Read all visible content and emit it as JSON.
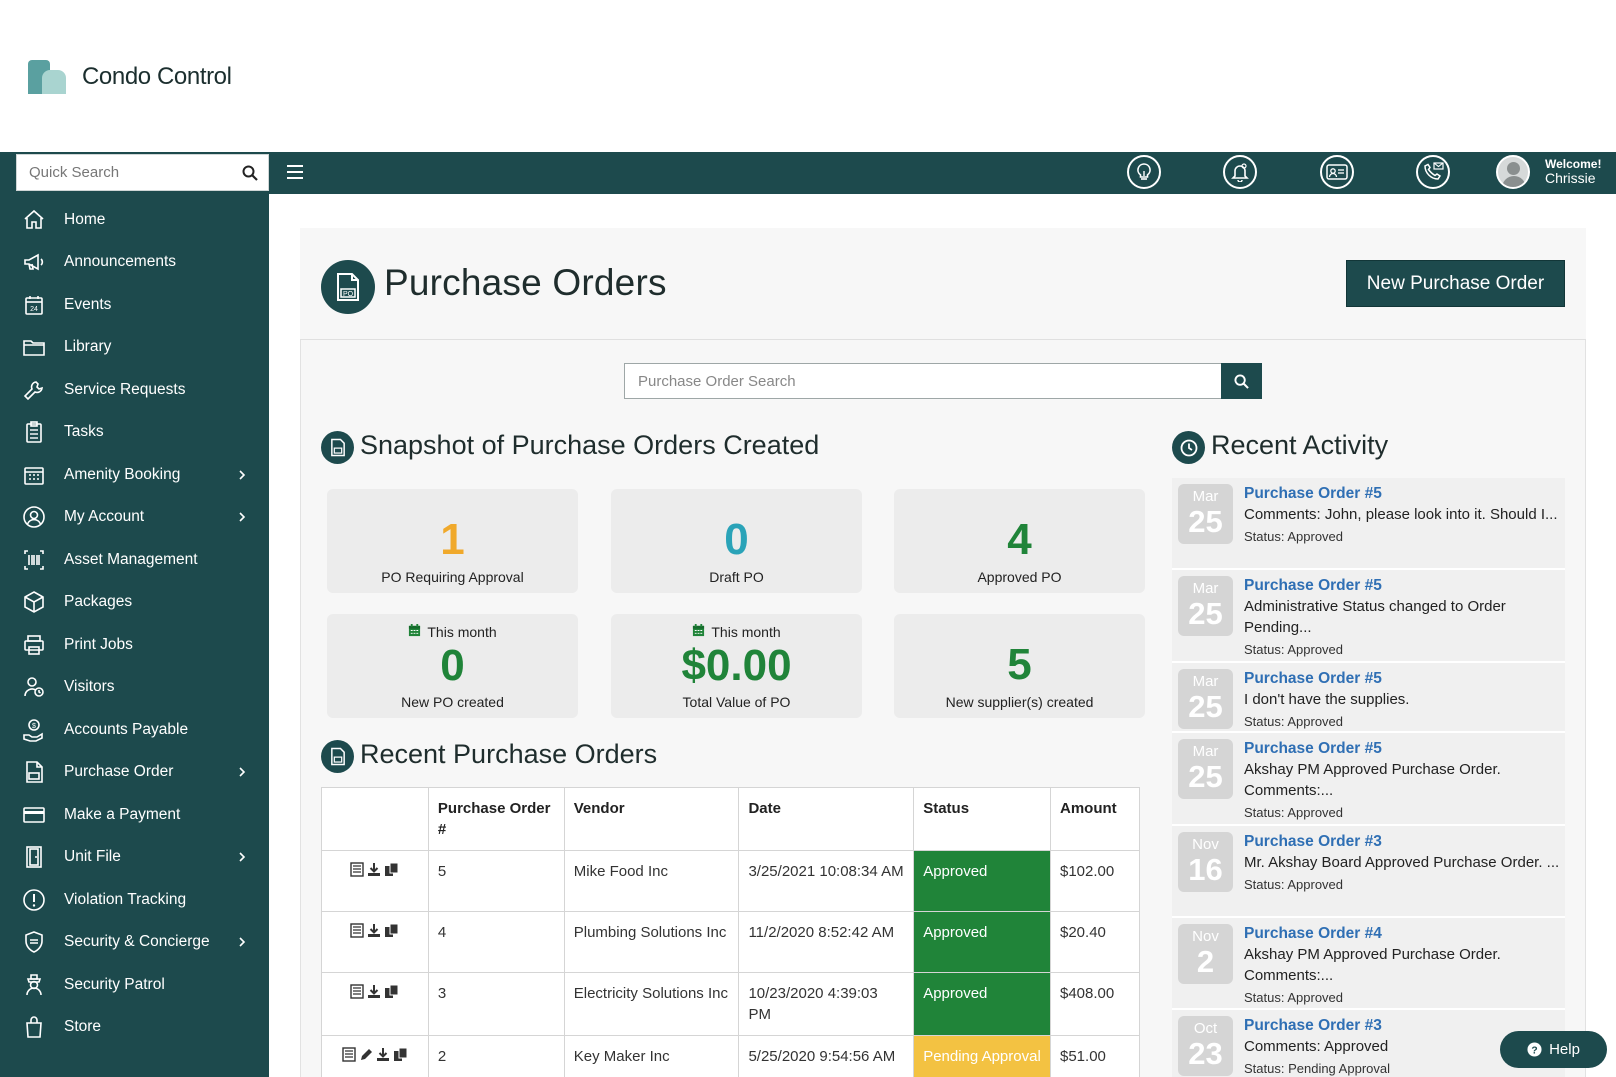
{
  "brand": {
    "name": "Condo Control"
  },
  "topbar": {
    "search_placeholder": "Quick Search",
    "welcome_label": "Welcome!",
    "user_name": "Chrissie",
    "icons": [
      "lightbulb-icon",
      "bell-icon",
      "id-card-icon",
      "phone-mail-icon"
    ]
  },
  "sidebar": {
    "items": [
      {
        "label": "Home",
        "icon": "home-icon",
        "has_submenu": false
      },
      {
        "label": "Announcements",
        "icon": "megaphone-icon",
        "has_submenu": false
      },
      {
        "label": "Events",
        "icon": "calendar-icon",
        "has_submenu": false
      },
      {
        "label": "Library",
        "icon": "folder-icon",
        "has_submenu": false
      },
      {
        "label": "Service Requests",
        "icon": "wrench-icon",
        "has_submenu": false
      },
      {
        "label": "Tasks",
        "icon": "clipboard-icon",
        "has_submenu": false
      },
      {
        "label": "Amenity Booking",
        "icon": "grid-calendar-icon",
        "has_submenu": true
      },
      {
        "label": "My Account",
        "icon": "user-circle-icon",
        "has_submenu": true
      },
      {
        "label": "Asset Management",
        "icon": "barcode-icon",
        "has_submenu": false
      },
      {
        "label": "Packages",
        "icon": "package-icon",
        "has_submenu": false
      },
      {
        "label": "Print Jobs",
        "icon": "printer-icon",
        "has_submenu": false
      },
      {
        "label": "Visitors",
        "icon": "visitor-icon",
        "has_submenu": false
      },
      {
        "label": "Accounts Payable",
        "icon": "money-hand-icon",
        "has_submenu": false
      },
      {
        "label": "Purchase Order",
        "icon": "po-document-icon",
        "has_submenu": true
      },
      {
        "label": "Make a Payment",
        "icon": "credit-card-icon",
        "has_submenu": false
      },
      {
        "label": "Unit File",
        "icon": "door-icon",
        "has_submenu": true
      },
      {
        "label": "Violation Tracking",
        "icon": "exclamation-circle-icon",
        "has_submenu": false
      },
      {
        "label": "Security & Concierge",
        "icon": "shield-icon",
        "has_submenu": true
      },
      {
        "label": "Security Patrol",
        "icon": "guard-icon",
        "has_submenu": false
      },
      {
        "label": "Store",
        "icon": "shopping-bag-icon",
        "has_submenu": false
      }
    ]
  },
  "page": {
    "title": "Purchase Orders",
    "new_button": "New Purchase Order",
    "search_placeholder": "Purchase Order Search"
  },
  "snapshot": {
    "title": "Snapshot of Purchase Orders Created",
    "cards": [
      {
        "value": "1",
        "label": "PO Requiring Approval",
        "color": "#f0a92b",
        "period": ""
      },
      {
        "value": "0",
        "label": "Draft PO",
        "color": "#2aa3b8",
        "period": ""
      },
      {
        "value": "4",
        "label": "Approved PO",
        "color": "#208439",
        "period": ""
      },
      {
        "value": "0",
        "label": "New PO created",
        "color": "#208439",
        "period": "This month"
      },
      {
        "value": "$0.00",
        "label": "Total Value of PO",
        "color": "#208439",
        "period": "This month"
      },
      {
        "value": "5",
        "label": "New supplier(s) created",
        "color": "#208439",
        "period": ""
      }
    ]
  },
  "recent_orders": {
    "title": "Recent Purchase Orders",
    "columns": [
      "",
      "Purchase Order #",
      "Vendor",
      "Date",
      "Status",
      "Amount"
    ],
    "rows": [
      {
        "number": "5",
        "vendor": "Mike Food Inc",
        "date": "3/25/2021 10:08:34 AM",
        "status": "Approved",
        "amount": "$102.00",
        "editable": false
      },
      {
        "number": "4",
        "vendor": "Plumbing Solutions Inc",
        "date": "11/2/2020 8:52:42 AM",
        "status": "Approved",
        "amount": "$20.40",
        "editable": false
      },
      {
        "number": "3",
        "vendor": "Electricity Solutions Inc",
        "date": "10/23/2020 4:39:03 PM",
        "status": "Approved",
        "amount": "$408.00",
        "editable": false
      },
      {
        "number": "2",
        "vendor": "Key Maker Inc",
        "date": "5/25/2020 9:54:56 AM",
        "status": "Pending Approval",
        "amount": "$51.00",
        "editable": true
      }
    ]
  },
  "activity": {
    "title": "Recent Activity",
    "items": [
      {
        "month": "Mar",
        "day": "25",
        "title": "Purchase Order #5",
        "body": "Comments: John, please look into it. Should I...",
        "status": "Status: Approved"
      },
      {
        "month": "Mar",
        "day": "25",
        "title": "Purchase Order #5",
        "body": "Administrative Status changed to Order Pending...",
        "status": "Status: Approved"
      },
      {
        "month": "Mar",
        "day": "25",
        "title": "Purchase Order #5",
        "body": "I don't have the supplies.",
        "status": "Status: Approved"
      },
      {
        "month": "Mar",
        "day": "25",
        "title": "Purchase Order #5",
        "body": "Akshay PM Approved Purchase Order. Comments:...",
        "status": "Status: Approved"
      },
      {
        "month": "Nov",
        "day": "16",
        "title": "Purchase Order #3",
        "body": "Mr. Akshay Board Approved Purchase Order. ...",
        "status": "Status: Approved"
      },
      {
        "month": "Nov",
        "day": "2",
        "title": "Purchase Order #4",
        "body": "Akshay PM Approved Purchase Order. Comments:...",
        "status": "Status: Approved"
      },
      {
        "month": "Oct",
        "day": "23",
        "title": "Purchase Order #3",
        "body": "Comments: Approved",
        "status": "Status: Pending Approval"
      }
    ]
  },
  "help": {
    "label": "Help"
  }
}
